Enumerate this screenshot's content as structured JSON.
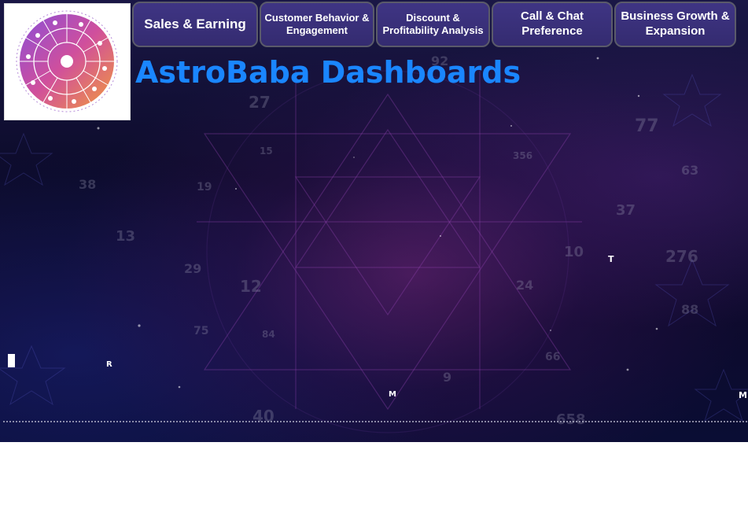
{
  "app": {
    "title": "AstroBaba Dashboards"
  },
  "nav": {
    "buttons": [
      {
        "label": "Sales  & Earning"
      },
      {
        "label": "Customer Behavior &\nEngagement"
      },
      {
        "label": "Discount &\nProfitability  Analysis"
      },
      {
        "label": "Call & Chat\nPreference"
      },
      {
        "label": "Business Growth &\nExpansion"
      }
    ]
  },
  "logo": {
    "icon": "zodiac-wheel-icon"
  },
  "background": {
    "numbers": [
      "27",
      "92",
      "77",
      "15",
      "356",
      "63",
      "19",
      "38",
      "37",
      "13",
      "276",
      "10",
      "29",
      "12",
      "24",
      "88",
      "75",
      "84",
      "9",
      "66",
      "40",
      "658"
    ]
  },
  "markers": [
    "T",
    "R",
    "M",
    "M"
  ],
  "colors": {
    "title": "#1a86ff",
    "nav_bg": "#3b3280",
    "nav_border": "#5a5a6a",
    "canvas_bg": "#0c0b2a"
  }
}
